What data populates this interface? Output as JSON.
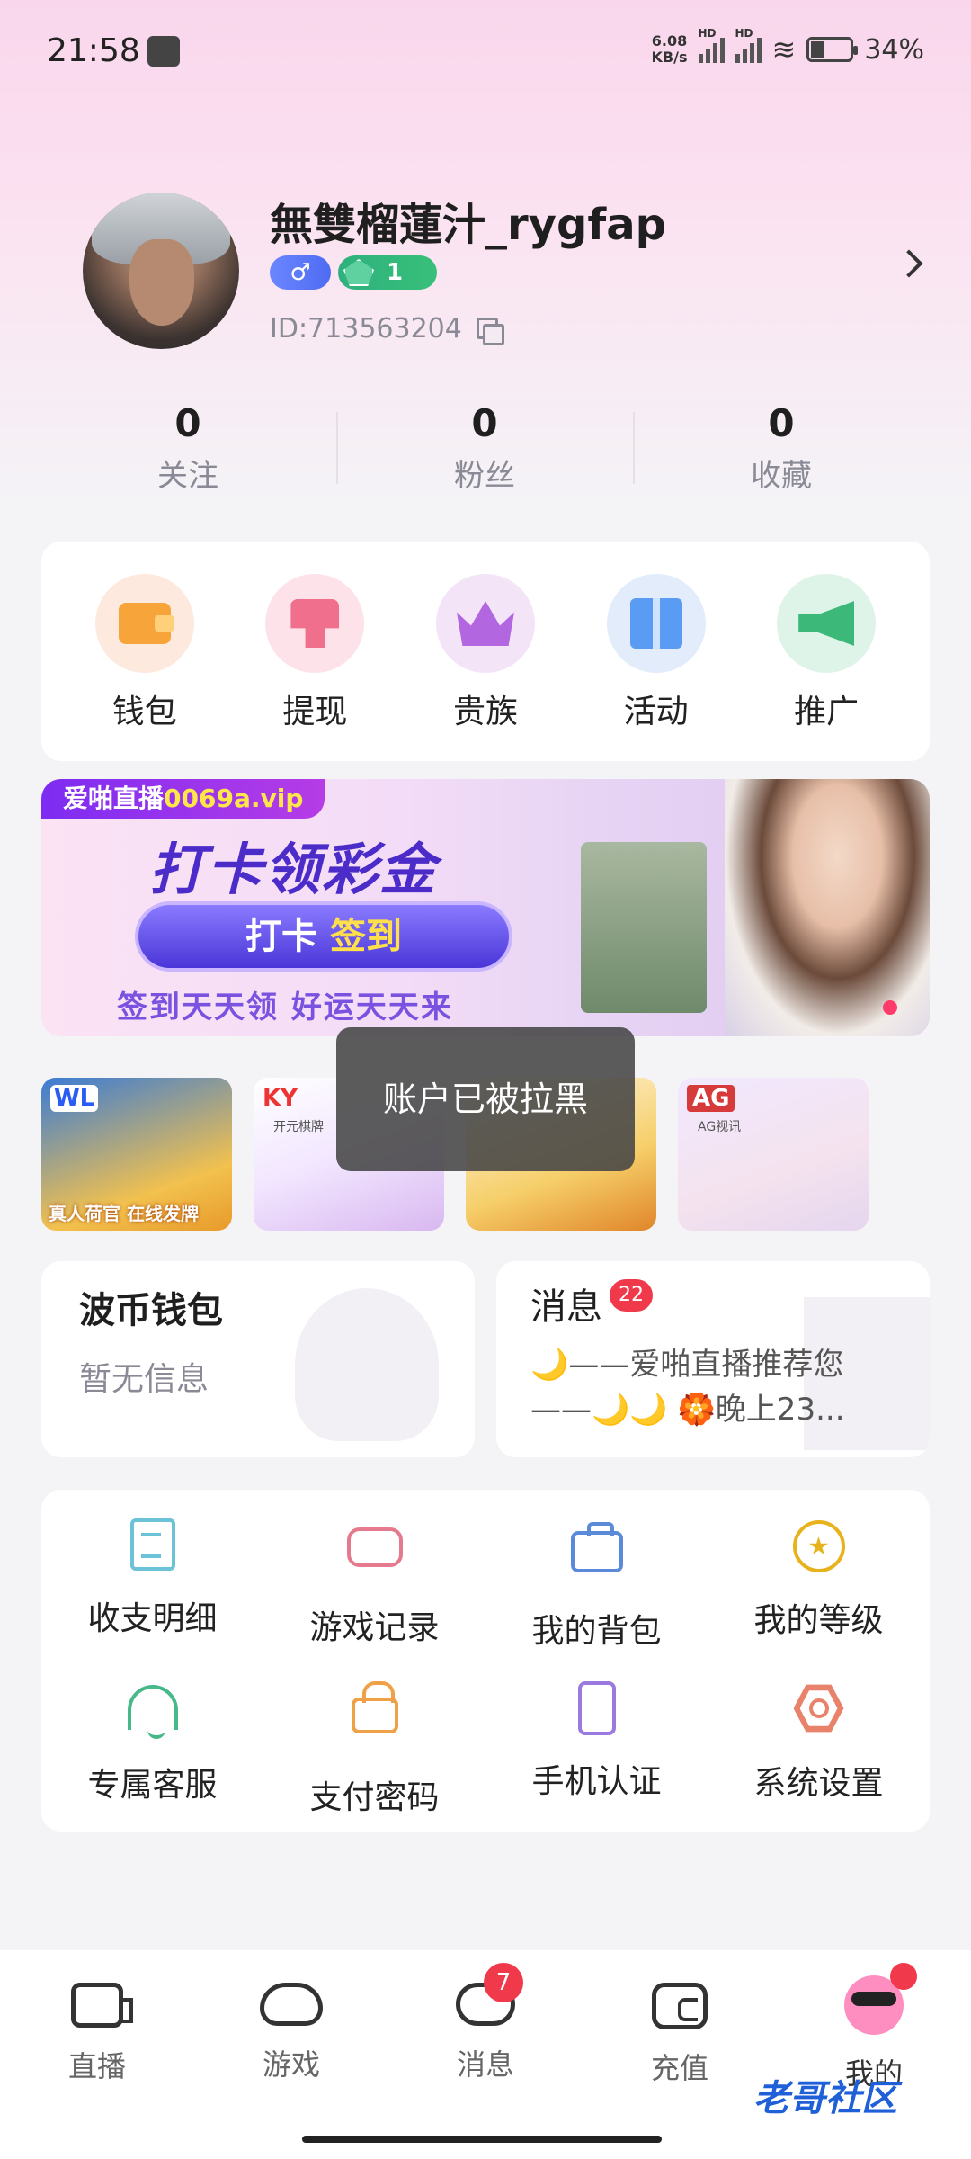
{
  "status_bar": {
    "time": "21:58",
    "speed_top": "6.08",
    "speed_unit": "KB/s",
    "hd1": "HD",
    "hd2": "HD",
    "battery": "34%"
  },
  "profile": {
    "username": "無雙榴蓮汁_rygfap",
    "gender_symbol": "♂",
    "level": "1",
    "id": "ID:713563204"
  },
  "stats": [
    {
      "value": "0",
      "label": "关注"
    },
    {
      "value": "0",
      "label": "粉丝"
    },
    {
      "value": "0",
      "label": "收藏"
    }
  ],
  "quick_actions": [
    {
      "label": "钱包",
      "icon": "wallet-icon",
      "bg": "#fde9dd"
    },
    {
      "label": "提现",
      "icon": "withdraw-icon",
      "bg": "#fde2ea"
    },
    {
      "label": "贵族",
      "icon": "crown-icon",
      "bg": "#f3e4f8"
    },
    {
      "label": "活动",
      "icon": "gift-icon",
      "bg": "#e2ecfb"
    },
    {
      "label": "推广",
      "icon": "megaphone-icon",
      "bg": "#dff4e8"
    }
  ],
  "banner": {
    "site_prefix": "爱啪直播",
    "site_url": "0069a.vip",
    "title": "打卡领彩金",
    "btn_left": "打卡",
    "btn_right": "签到",
    "subtitle": "签到天天领  好运天天来"
  },
  "game_tiles": [
    {
      "logo": "WL",
      "sublogo": "",
      "caption": "真人荷官 在线发牌"
    },
    {
      "logo": "KY",
      "sublogo": "开元棋牌",
      "caption": ""
    },
    {
      "logo": "",
      "sublogo": "",
      "caption": ""
    },
    {
      "logo": "AG",
      "sublogo": "AG视讯",
      "caption": ""
    }
  ],
  "toast": "账户已被拉黑",
  "wallet_card": {
    "title": "波币钱包",
    "subtitle": "暂无信息"
  },
  "message_card": {
    "title": "消息",
    "badge": "22",
    "preview": "🌙——爱啪直播推荐您——🌙🌙 🏵️晚上23..."
  },
  "menu": [
    {
      "label": "收支明细",
      "icon": "document-icon"
    },
    {
      "label": "游戏记录",
      "icon": "gamepad-icon"
    },
    {
      "label": "我的背包",
      "icon": "backpack-icon"
    },
    {
      "label": "我的等级",
      "icon": "star-level-icon"
    },
    {
      "label": "专属客服",
      "icon": "headset-icon"
    },
    {
      "label": "支付密码",
      "icon": "lock-icon"
    },
    {
      "label": "手机认证",
      "icon": "phone-check-icon"
    },
    {
      "label": "系统设置",
      "icon": "settings-hex-icon"
    }
  ],
  "bottom_nav": [
    {
      "label": "直播",
      "icon": "camera-icon"
    },
    {
      "label": "游戏",
      "icon": "gamepad-icon"
    },
    {
      "label": "消息",
      "icon": "chat-icon",
      "badge": "7"
    },
    {
      "label": "充值",
      "icon": "wallet-icon"
    },
    {
      "label": "我的",
      "icon": "profile-icon"
    }
  ],
  "watermark": "老哥社区"
}
